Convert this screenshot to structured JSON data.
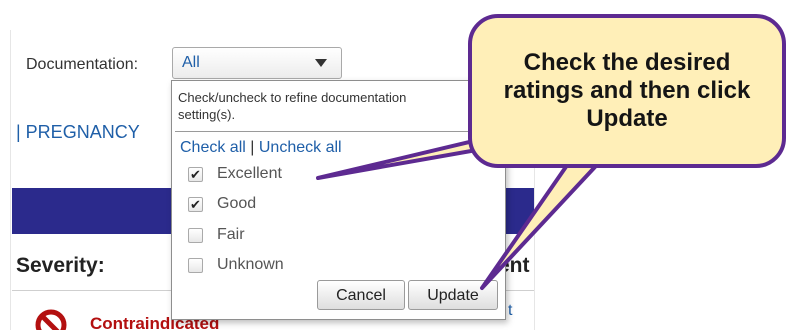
{
  "filter": {
    "label": "Documentation:",
    "selected": "All"
  },
  "nav": {
    "pregnancy": "| PREGNANCY"
  },
  "dropdown": {
    "help_line1": "Check/uncheck to refine documentation",
    "help_line2": "setting(s).",
    "check_all": "Check all",
    "link_sep": "|",
    "uncheck_all": "Uncheck all",
    "options": [
      {
        "label": "Excellent",
        "checked": true
      },
      {
        "label": "Good",
        "checked": true
      },
      {
        "label": "Fair",
        "checked": false
      },
      {
        "label": "Unknown",
        "checked": false
      }
    ],
    "cancel_label": "Cancel",
    "update_label": "Update"
  },
  "table": {
    "severity_header": "Severity:",
    "next_header_fragment": "ent",
    "row_severity": "Contraindicated",
    "row_right_fragment": "t"
  },
  "callout": {
    "text": "Check the desired ratings and then click Update"
  },
  "colors": {
    "accent_blue": "#1f5fa8",
    "header_bar": "#2b2a8c",
    "callout_fill": "#ffefb8",
    "callout_border": "#5d2a91",
    "contraindicated_red": "#b31010"
  }
}
